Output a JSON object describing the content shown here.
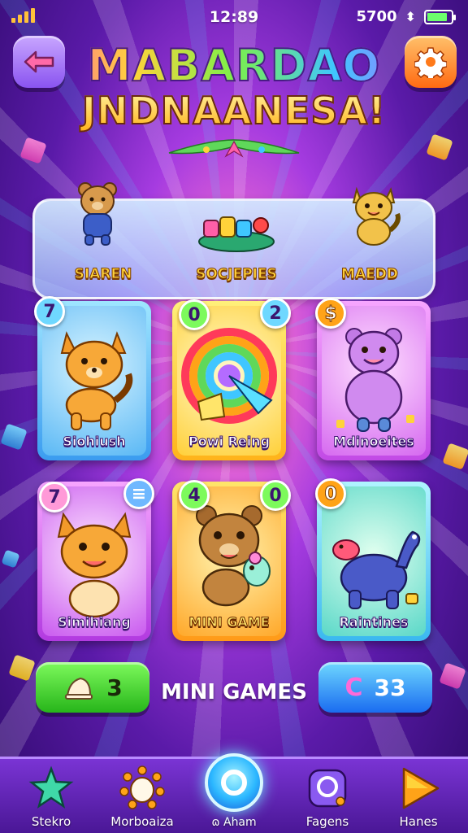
{
  "status_bar": {
    "time": "12:89",
    "right_text": "5700",
    "battery_level": 0.85
  },
  "header": {
    "back_icon": "back-arrow-icon",
    "settings_icon": "gear-icon",
    "title_line1": "MABARDAO",
    "title_line2": "JNDNAANESA!"
  },
  "top_panel": {
    "items": [
      {
        "label": "SIAREN",
        "icon": "bear-character-icon"
      },
      {
        "label": "SOCJEPIES",
        "icon": "puzzle-platform-icon"
      },
      {
        "label": "MAEDD",
        "icon": "cat-character-icon"
      }
    ]
  },
  "cards": [
    {
      "label": "Siohiush",
      "badge_left": "7",
      "badge_right": "",
      "icon": "orange-dog-icon"
    },
    {
      "label": "Powi Reing",
      "badge_left": "0",
      "badge_right": "2",
      "icon": "rainbow-wheel-icon"
    },
    {
      "label": "Mdinoeites",
      "badge_left": "",
      "badge_right": "$",
      "icon": "purple-bear-icon"
    },
    {
      "label": "Simihiang",
      "badge_left": "7",
      "badge_right": "≡",
      "icon": "cat-face-icon"
    },
    {
      "label": "MINI GAME",
      "badge_left": "4",
      "badge_right": "0",
      "icon": "teddy-bear-icon"
    },
    {
      "label": "Raintines",
      "badge_left": "0",
      "badge_right": "",
      "icon": "blue-dino-icon"
    }
  ],
  "actions": {
    "left_value": "3",
    "left_icon": "bell-icon",
    "right_value": "33",
    "right_icon": "c-coin-icon",
    "mini_games_label": "MINI GAMES"
  },
  "nav": {
    "items": [
      {
        "label": "Stekro",
        "icon": "star-icon"
      },
      {
        "label": "Morboaiza",
        "icon": "sun-egg-icon"
      },
      {
        "label": "ɷ Aham",
        "icon": "ring-icon"
      },
      {
        "label": "Fagens",
        "icon": "rounded-square-icon"
      },
      {
        "label": "Hanes",
        "icon": "play-triangle-icon"
      }
    ]
  },
  "colors": {
    "background_primary": "#a53be0",
    "accent_yellow": "#ffd33a",
    "accent_green": "#27b51a",
    "accent_blue": "#1a6cf0",
    "accent_orange": "#ff6a12"
  }
}
